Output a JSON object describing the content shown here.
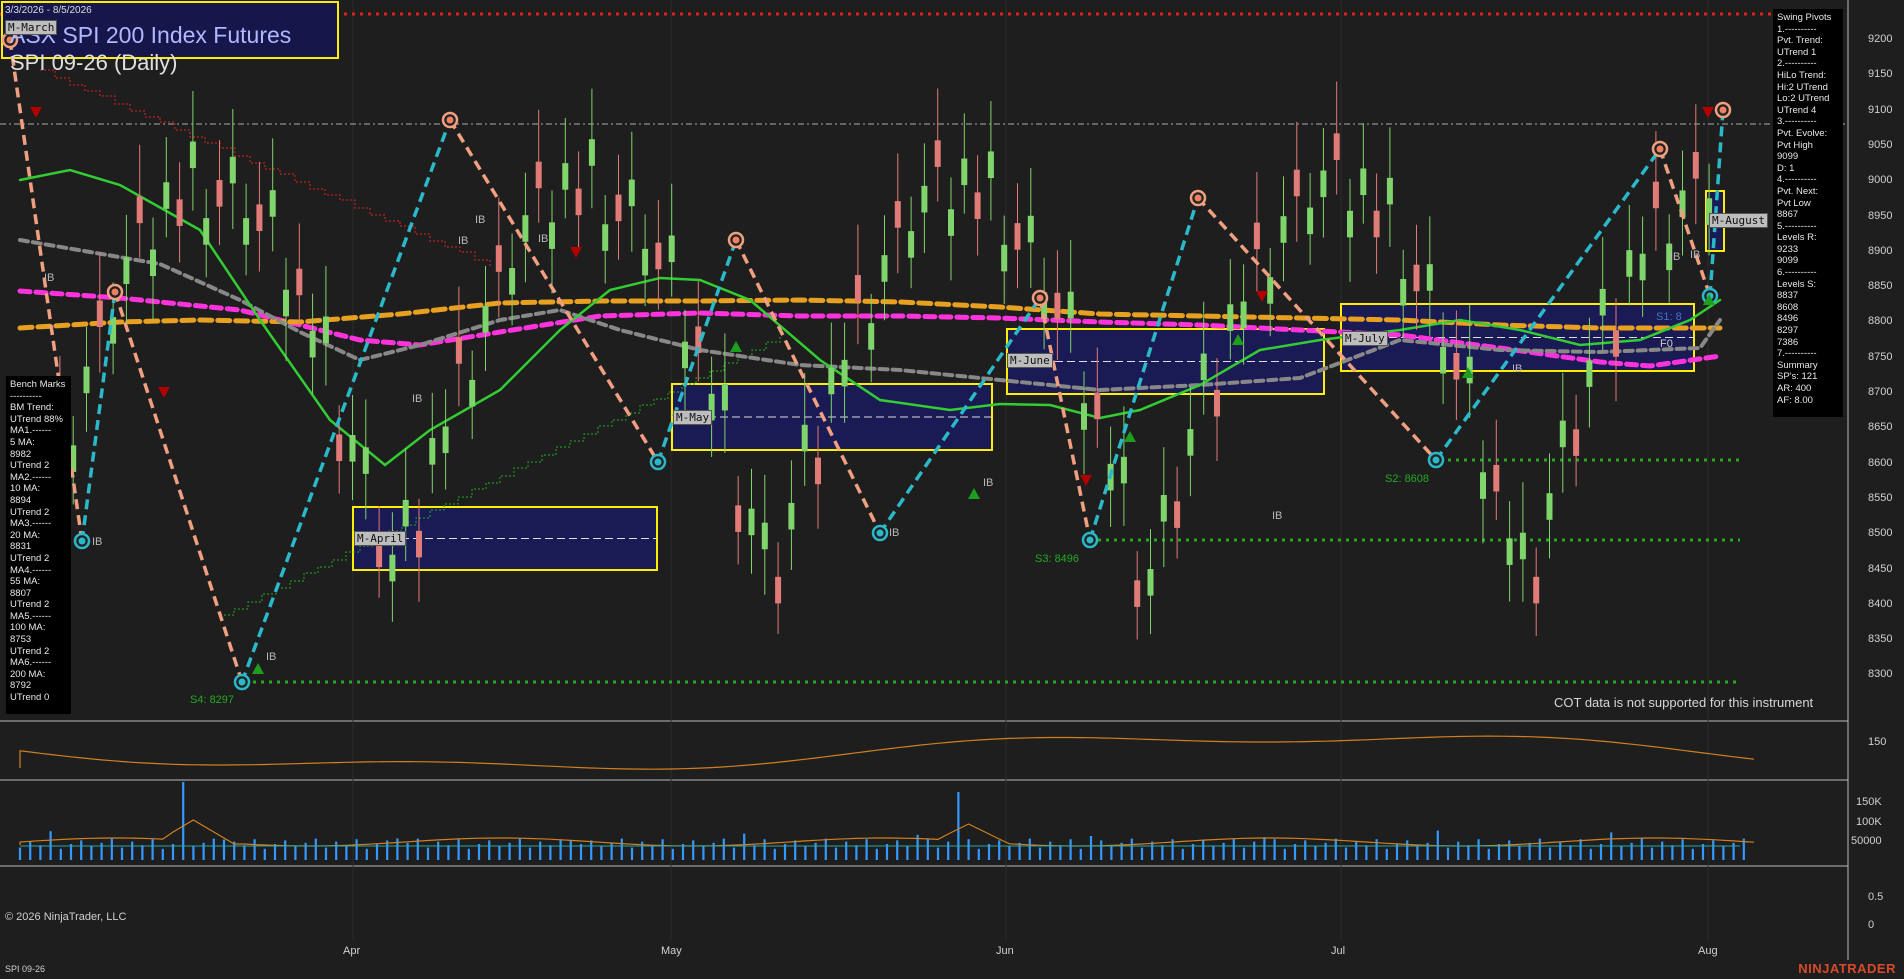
{
  "header": {
    "date_range": "3/3/2026 - 8/5/2026",
    "instrument_title": "ASX SPI 200 Index Futures",
    "contract_title": "SPI 09-26 (Daily)",
    "corner_tag": "M-March"
  },
  "swing_pivots_panel": "Swing Pivots\n1.----------\nPvt. Trend:\nUTrend 1\n2.----------\nHiLo Trend:\nHi:2 UTrend\nLo:2 UTrend\nUTrend 4\n3.----------\nPvt. Evolve:\nPvt High\n9099\nD: 1\n4.----------\nPvt. Next:\nPvt Low\n8867\n5.----------\nLevels R:\n9233\n9099\n6.----------\nLevels S:\n8837\n8608\n8496\n8297\n7386\n7.----------\nSummary\nSP's: 121\nAR: 400\nAF: 8.00",
  "bench_marks_panel": "Bench Marks\n----------\nBM Trend:\nUTrend 88%\nMA1.------\n5 MA:\n8982\nUTrend 2\nMA2.------\n10 MA:\n8894\nUTrend 2\nMA3.------\n20 MA:\n8831\nUTrend 2\nMA4.------\n55 MA:\n8807\nUTrend 2\nMA5.------\n100 MA:\n8753\nUTrend 2\nMA6.------\n200 MA:\n8792\nUTrend 0",
  "price_axis": [
    "9200",
    "9150",
    "9100",
    "9050",
    "9000",
    "8950",
    "8900",
    "8850",
    "8800",
    "8750",
    "8700",
    "8650",
    "8600",
    "8550",
    "8500",
    "8450",
    "8400",
    "8350",
    "8300"
  ],
  "indicator_axis": [
    "150"
  ],
  "volume_axis": [
    "150K",
    "100K",
    "50000"
  ],
  "cot_axis": [
    "0.5",
    "0"
  ],
  "months": [
    "Apr",
    "May",
    "Jun",
    "Jul",
    "Aug"
  ],
  "support_labels": [
    "S4: 8297",
    "S3: 8496",
    "S2: 8608",
    "S1: 8"
  ],
  "monthly_tags": [
    "M-April",
    "M-May",
    "M-June",
    "M-July",
    "M-August"
  ],
  "ib_label": "IB",
  "fo_label": "F0",
  "cot_message": "COT data is not supported for this instrument",
  "copyright": "© 2026 NinjaTrader, LLC",
  "instrument_footer": "SPI 09-26",
  "brand": "NINJATRADER",
  "colors": {
    "background": "#1e1e1e",
    "up_bar": "#7fd46b",
    "down_bar": "#e07b78",
    "swing_up": "#2bb8c9",
    "swing_down": "#f0a080",
    "ma_magenta": "#ff33dd",
    "ma_orange": "#e8a020",
    "ma_green": "#33cc33",
    "resistance": "#e02020",
    "support": "#22aa22",
    "box_border": "#ffee00",
    "box_fill": "#1a1a5e"
  }
}
